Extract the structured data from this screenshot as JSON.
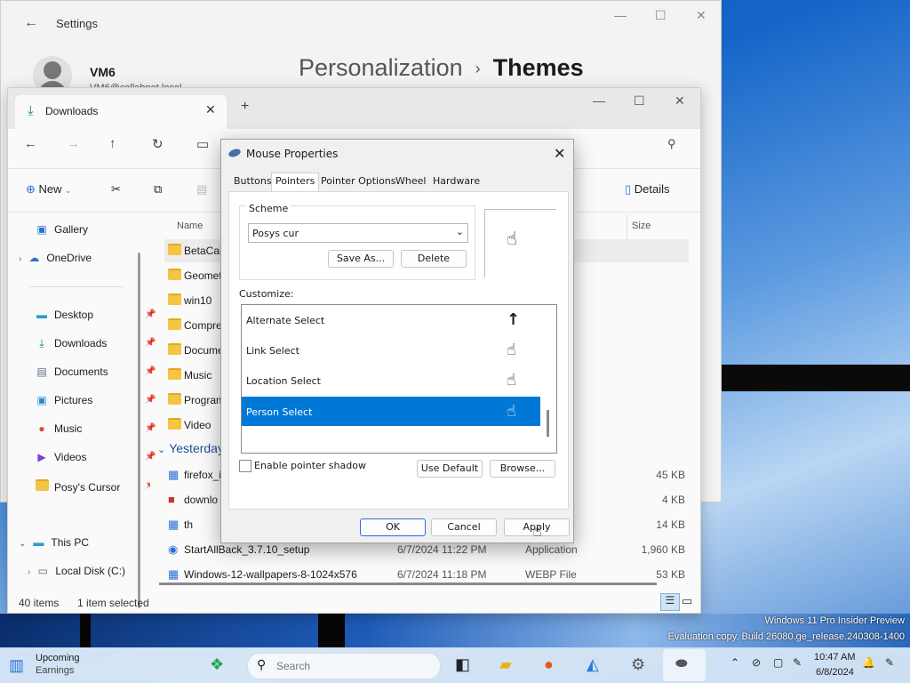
{
  "settings": {
    "title": "Settings",
    "user_name": "VM6",
    "user_email": "VM6@callabnet.local",
    "breadcrumb_parent": "Personalization",
    "breadcrumb_current": "Themes"
  },
  "explorer": {
    "tab_title": "Downloads",
    "commands": {
      "new": "New",
      "details": "Details"
    },
    "sidebar": [
      {
        "label": "Gallery",
        "icon": "gallery-icon"
      },
      {
        "label": "OneDrive",
        "icon": "cloud-icon"
      },
      {
        "label": "Desktop",
        "icon": "desktop-icon"
      },
      {
        "label": "Downloads",
        "icon": "download-icon"
      },
      {
        "label": "Documents",
        "icon": "documents-icon"
      },
      {
        "label": "Pictures",
        "icon": "pictures-icon"
      },
      {
        "label": "Music",
        "icon": "music-icon"
      },
      {
        "label": "Videos",
        "icon": "videos-icon"
      },
      {
        "label": "Posy's Cursor",
        "icon": "folder-icon"
      },
      {
        "label": "This PC",
        "icon": "pc-icon"
      },
      {
        "label": "Local Disk (C:)",
        "icon": "disk-icon"
      }
    ],
    "columns": {
      "name": "Name",
      "size": "Size"
    },
    "folders": [
      "BetaCalc",
      "Geomet",
      "win10",
      "Compre",
      "Docume",
      "Music",
      "Program",
      "Video"
    ],
    "group_label": "Yesterday",
    "files": [
      {
        "name": "firefox_i",
        "date": "",
        "type": "",
        "size": "45 KB"
      },
      {
        "name": "downlo",
        "date": "",
        "type": "ML Doc...",
        "size": "4 KB"
      },
      {
        "name": "th",
        "date": "",
        "type": "",
        "size": "14 KB"
      },
      {
        "name": "StartAllBack_3.7.10_setup",
        "date": "6/7/2024 11:22 PM",
        "type": "Application",
        "size": "1,960 KB"
      },
      {
        "name": "Windows-12-wallpapers-8-1024x576",
        "date": "6/7/2024 11:18 PM",
        "type": "WEBP File",
        "size": "53 KB"
      }
    ],
    "status": {
      "count": "40 items",
      "selected": "1 item selected"
    }
  },
  "dialog": {
    "title": "Mouse Properties",
    "tabs": [
      "Buttons",
      "Pointers",
      "Pointer Options",
      "Wheel",
      "Hardware"
    ],
    "active_tab": "Pointers",
    "scheme_label": "Scheme",
    "scheme_value": "Posys cur",
    "save_as": "Save As...",
    "delete": "Delete",
    "customize_label": "Customize:",
    "items": [
      {
        "label": "Alternate Select",
        "cursor": "↑"
      },
      {
        "label": "Link Select",
        "cursor": "☝"
      },
      {
        "label": "Location Select",
        "cursor": "☝"
      },
      {
        "label": "Person Select",
        "cursor": "☝",
        "selected": true
      }
    ],
    "shadow_label": "Enable pointer shadow",
    "use_default": "Use Default",
    "browse": "Browse...",
    "ok": "OK",
    "cancel": "Cancel",
    "apply": "Apply"
  },
  "taskbar": {
    "weather_line1": "Upcoming",
    "weather_line2": "Earnings",
    "search_placeholder": "Search",
    "time": "10:47 AM",
    "date": "6/8/2024"
  },
  "watermark": {
    "line1": "Windows 11 Pro Insider Preview",
    "line2": "Evaluation copy. Build 26080.ge_release.240308-1400"
  }
}
